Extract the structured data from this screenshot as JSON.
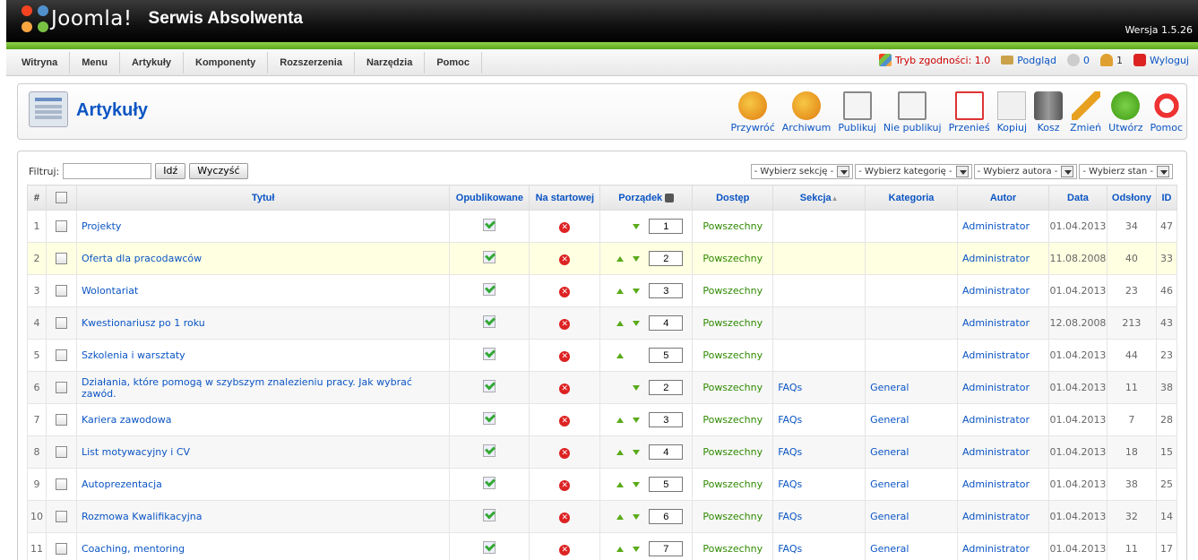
{
  "header": {
    "logo_text": "Joomla!",
    "site_name": "Serwis Absolwenta",
    "version": "Wersja 1.5.26"
  },
  "menu": [
    "Witryna",
    "Menu",
    "Artykuły",
    "Komponenty",
    "Rozszerzenia",
    "Narzędzia",
    "Pomoc"
  ],
  "status": {
    "compat": "Tryb zgodności: 1.0",
    "preview": "Podgląd",
    "messages": "0",
    "users": "1",
    "logout": "Wyloguj"
  },
  "page": {
    "title": "Artykuły"
  },
  "toolbar": [
    "Przywróć",
    "Archiwum",
    "Publikuj",
    "Nie publikuj",
    "Przenieś",
    "Kopiuj",
    "Kosz",
    "Zmień",
    "Utwórz",
    "Pomoc"
  ],
  "filter": {
    "label": "Filtruj:",
    "value": "",
    "go": "Idź",
    "reset": "Wyczyść",
    "selects": [
      "- Wybierz sekcję -",
      "- Wybierz kategorię -",
      "- Wybierz autora -",
      "- Wybierz stan -"
    ]
  },
  "columns": [
    "#",
    "Tytuł",
    "Opublikowane",
    "Na startowej",
    "Porządek",
    "Dostęp",
    "Sekcja",
    "Kategoria",
    "Autor",
    "Data",
    "Odsłony",
    "ID"
  ],
  "sort_arrow": "▲",
  "rows": [
    {
      "n": "1",
      "title": "Projekty",
      "order": "1",
      "access": "Powszechny",
      "section": "",
      "category": "",
      "author": "Administrator",
      "date": "01.04.2013",
      "hits": "34",
      "id": "47",
      "up": false,
      "down": true
    },
    {
      "n": "2",
      "title": "Oferta dla pracodawców",
      "order": "2",
      "access": "Powszechny",
      "section": "",
      "category": "",
      "author": "Administrator",
      "date": "11.08.2008",
      "hits": "40",
      "id": "33",
      "up": true,
      "down": true
    },
    {
      "n": "3",
      "title": "Wolontariat",
      "order": "3",
      "access": "Powszechny",
      "section": "",
      "category": "",
      "author": "Administrator",
      "date": "01.04.2013",
      "hits": "23",
      "id": "46",
      "up": true,
      "down": true
    },
    {
      "n": "4",
      "title": "Kwestionariusz po 1 roku",
      "order": "4",
      "access": "Powszechny",
      "section": "",
      "category": "",
      "author": "Administrator",
      "date": "12.08.2008",
      "hits": "213",
      "id": "43",
      "up": true,
      "down": true
    },
    {
      "n": "5",
      "title": "Szkolenia i warsztaty",
      "order": "5",
      "access": "Powszechny",
      "section": "",
      "category": "",
      "author": "Administrator",
      "date": "01.04.2013",
      "hits": "44",
      "id": "23",
      "up": true,
      "down": false
    },
    {
      "n": "6",
      "title": "Działania, które pomogą w szybszym znalezieniu pracy. Jak wybrać zawód.",
      "order": "2",
      "access": "Powszechny",
      "section": "FAQs",
      "category": "General",
      "author": "Administrator",
      "date": "01.04.2013",
      "hits": "11",
      "id": "38",
      "up": false,
      "down": true
    },
    {
      "n": "7",
      "title": "Kariera zawodowa",
      "order": "3",
      "access": "Powszechny",
      "section": "FAQs",
      "category": "General",
      "author": "Administrator",
      "date": "01.04.2013",
      "hits": "7",
      "id": "28",
      "up": true,
      "down": true
    },
    {
      "n": "8",
      "title": "List motywacyjny i CV",
      "order": "4",
      "access": "Powszechny",
      "section": "FAQs",
      "category": "General",
      "author": "Administrator",
      "date": "01.04.2013",
      "hits": "18",
      "id": "15",
      "up": true,
      "down": true
    },
    {
      "n": "9",
      "title": "Autoprezentacja",
      "order": "5",
      "access": "Powszechny",
      "section": "FAQs",
      "category": "General",
      "author": "Administrator",
      "date": "01.04.2013",
      "hits": "38",
      "id": "25",
      "up": true,
      "down": true
    },
    {
      "n": "10",
      "title": "Rozmowa Kwalifikacyjna",
      "order": "6",
      "access": "Powszechny",
      "section": "FAQs",
      "category": "General",
      "author": "Administrator",
      "date": "01.04.2013",
      "hits": "32",
      "id": "14",
      "up": true,
      "down": true
    },
    {
      "n": "11",
      "title": "Coaching, mentoring",
      "order": "7",
      "access": "Powszechny",
      "section": "FAQs",
      "category": "General",
      "author": "Administrator",
      "date": "01.04.2013",
      "hits": "11",
      "id": "17",
      "up": true,
      "down": true
    }
  ]
}
